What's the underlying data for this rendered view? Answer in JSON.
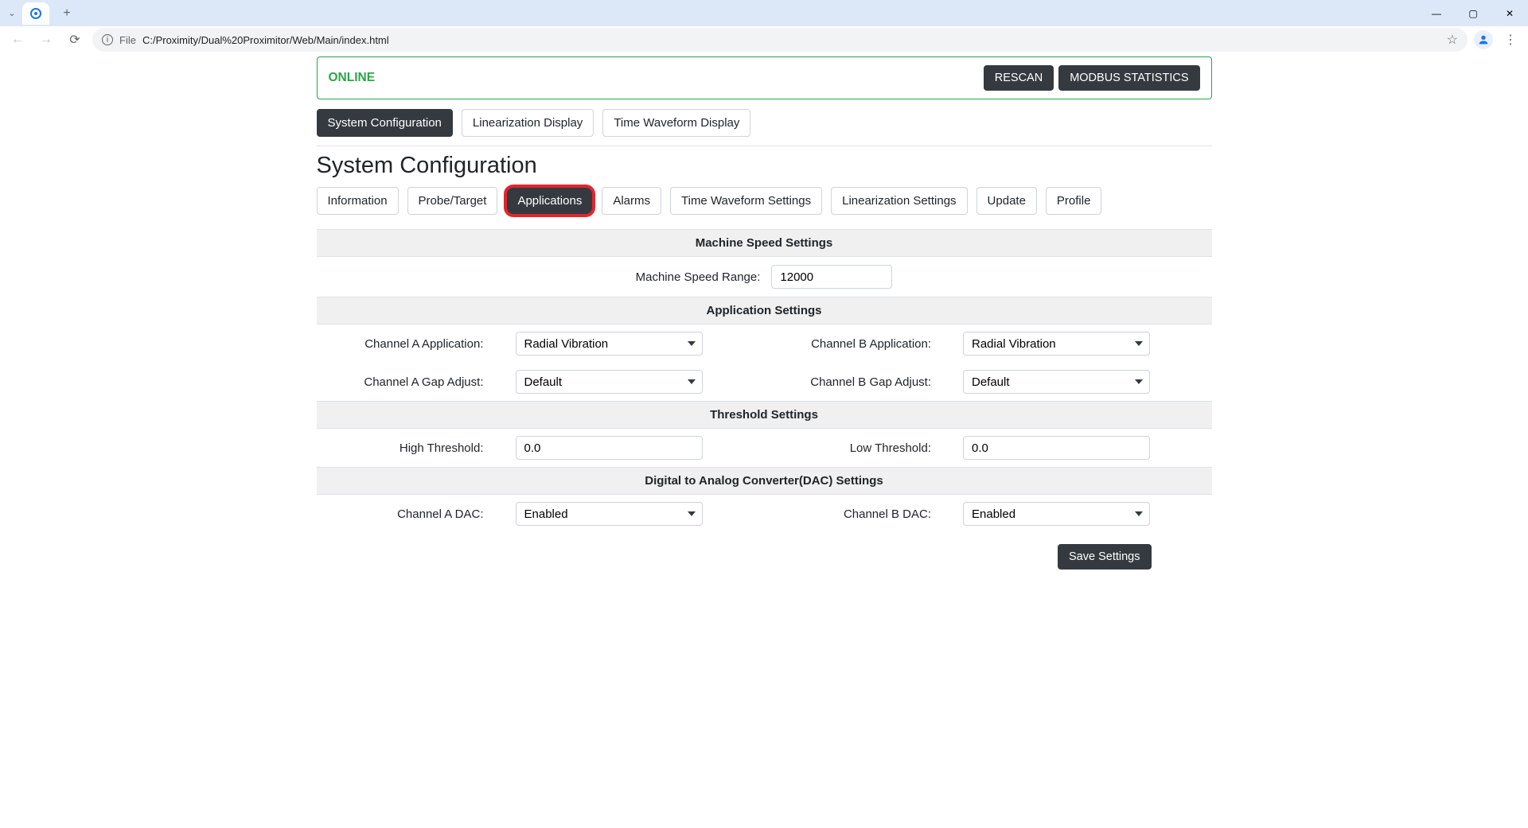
{
  "browser": {
    "url_prefix": "File",
    "url": "C:/Proximity/Dual%20Proximitor/Web/Main/index.html"
  },
  "status": {
    "text": "ONLINE",
    "rescan": "RESCAN",
    "modbus": "MODBUS STATISTICS"
  },
  "mainTabs": {
    "sysconfig": "System Configuration",
    "lin": "Linearization Display",
    "twd": "Time Waveform Display"
  },
  "pageTitle": "System Configuration",
  "subTabs": {
    "information": "Information",
    "probetarget": "Probe/Target",
    "applications": "Applications",
    "alarms": "Alarms",
    "tws": "Time Waveform Settings",
    "ls": "Linearization Settings",
    "update": "Update",
    "profile": "Profile"
  },
  "sections": {
    "machineSpeed": "Machine Speed Settings",
    "appSettings": "Application Settings",
    "threshold": "Threshold Settings",
    "dac": "Digital to Analog Converter(DAC) Settings"
  },
  "machineSpeed": {
    "label": "Machine Speed Range:",
    "value": "12000"
  },
  "app": {
    "chAAppLabel": "Channel A Application:",
    "chAAppValue": "Radial Vibration",
    "chBAppLabel": "Channel B Application:",
    "chBAppValue": "Radial Vibration",
    "chAGapLabel": "Channel A Gap Adjust:",
    "chAGapValue": "Default",
    "chBGapLabel": "Channel B Gap Adjust:",
    "chBGapValue": "Default"
  },
  "threshold": {
    "highLabel": "High Threshold:",
    "highValue": "0.0",
    "lowLabel": "Low Threshold:",
    "lowValue": "0.0"
  },
  "dac": {
    "chALabel": "Channel A DAC:",
    "chAValue": "Enabled",
    "chBLabel": "Channel B DAC:",
    "chBValue": "Enabled"
  },
  "save": "Save Settings"
}
